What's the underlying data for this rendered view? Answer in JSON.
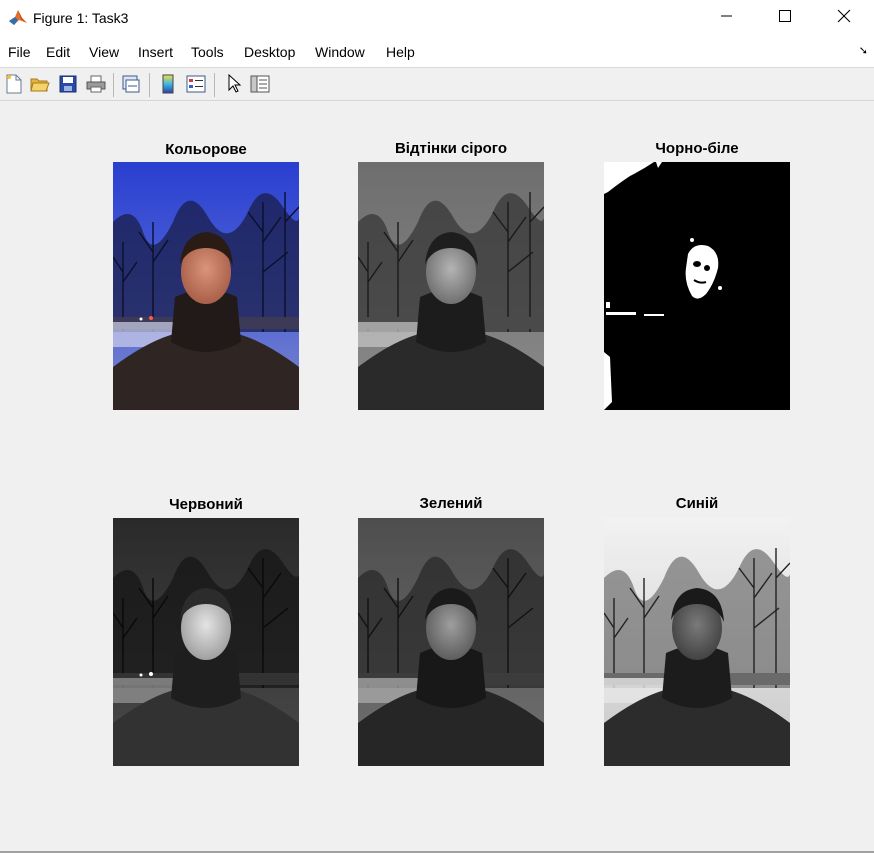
{
  "window": {
    "title": "Figure 1: Task3",
    "icon": "matlab-logo-icon",
    "controls": [
      "minimize-icon",
      "maximize-icon",
      "close-icon"
    ]
  },
  "menu": [
    "File",
    "Edit",
    "View",
    "Insert",
    "Tools",
    "Desktop",
    "Window",
    "Help"
  ],
  "toolbar": {
    "buttons": [
      "new-figure-icon",
      "open-file-icon",
      "save-icon",
      "print-icon",
      "link-plot-icon",
      "insert-colorbar-icon",
      "insert-legend-icon",
      "edit-plot-pointer-icon",
      "property-inspector-icon"
    ]
  },
  "figure": {
    "subplots": [
      {
        "title": "Кольорове",
        "mode": "color"
      },
      {
        "title": "Відтінки сірого",
        "mode": "gray"
      },
      {
        "title": "Чорно-біле",
        "mode": "binary"
      },
      {
        "title": "Червоний",
        "mode": "red-channel"
      },
      {
        "title": "Зелений",
        "mode": "green-channel"
      },
      {
        "title": "Синій",
        "mode": "blue-channel"
      }
    ]
  }
}
